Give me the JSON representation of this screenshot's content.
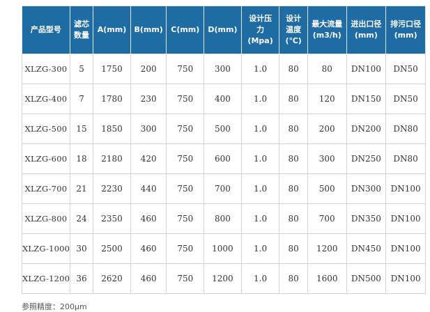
{
  "table": {
    "headers": [
      "产品型号",
      "滤芯\n数量",
      "A(mm)",
      "B(mm)",
      "C(mm)",
      "D(mm)",
      "设计压\n力\n(Mpa)",
      "设计\n温度\n(℃)",
      "最大流量\n(m3/h)",
      "进出口径\n(mm)",
      "排污口径\n(mm)"
    ],
    "rows": [
      [
        "XLZG-300",
        "5",
        "1750",
        "200",
        "750",
        "300",
        "1.0",
        "80",
        "80",
        "DN100",
        "DN50"
      ],
      [
        "XLZG-400",
        "7",
        "1780",
        "230",
        "750",
        "400",
        "1.0",
        "80",
        "120",
        "DN150",
        "DN50"
      ],
      [
        "XLZG-500",
        "15",
        "1850",
        "300",
        "750",
        "500",
        "1.0",
        "80",
        "200",
        "DN200",
        "DN80"
      ],
      [
        "XLZG-600",
        "18",
        "2180",
        "420",
        "750",
        "600",
        "1.0",
        "80",
        "300",
        "DN250",
        "DN80"
      ],
      [
        "XLZG-700",
        "21",
        "2230",
        "440",
        "750",
        "700",
        "1.0",
        "80",
        "500",
        "DN300",
        "DN100"
      ],
      [
        "XLZG-800",
        "24",
        "2350",
        "460",
        "750",
        "800",
        "1.0",
        "80",
        "700",
        "DN350",
        "DN100"
      ],
      [
        "XLZG-1000",
        "30",
        "2500",
        "460",
        "750",
        "1000",
        "1.0",
        "80",
        "1200",
        "DN450",
        "DN100"
      ],
      [
        "XLZG-1200",
        "36",
        "2620",
        "460",
        "750",
        "1200",
        "1.0",
        "80",
        "1600",
        "DN500",
        "DN100"
      ]
    ]
  },
  "note": "参照精度：200μm",
  "colors": {
    "header_bg": "#1f6ba3",
    "header_text": "#ffffff",
    "border": "#d2d2d2",
    "cell_text": "#333333"
  }
}
